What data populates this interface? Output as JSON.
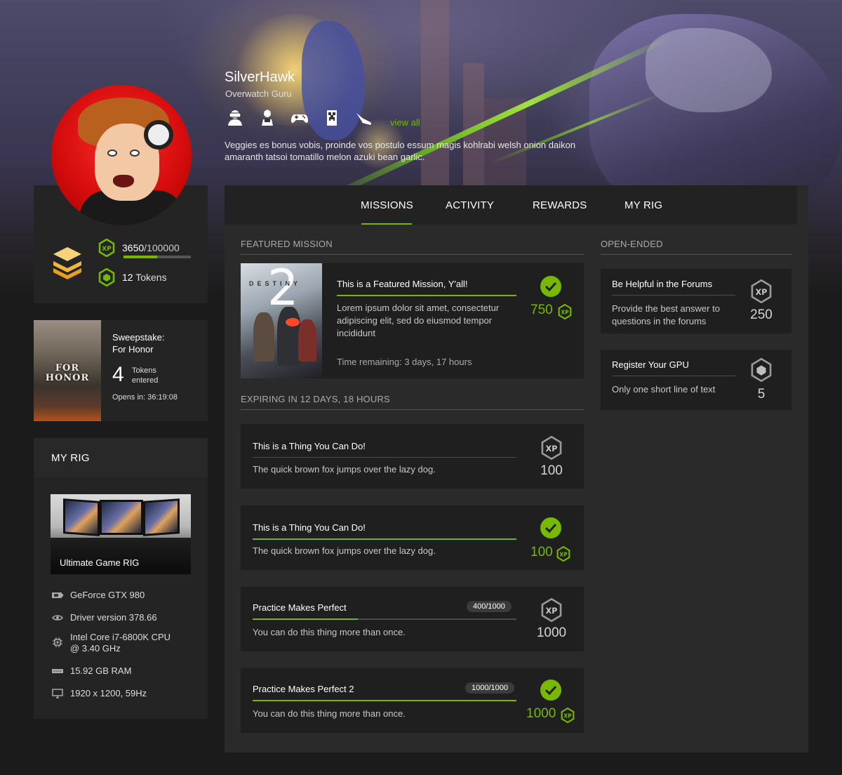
{
  "profile": {
    "username": "SilverHawk",
    "title": "Overwatch Guru",
    "badges": [
      "vr-headset-icon",
      "hacker-icon",
      "gamepad-icon",
      "creeper-icon",
      "shuttle-icon"
    ],
    "view_all": "view all",
    "bio": "Veggies es bonus vobis, proinde vos postulo essum magis kohlrabi welsh onion daikon amaranth tatsoi tomatillo melon azuki bean garlic."
  },
  "stats": {
    "xp_current": "3650",
    "xp_total": "/100000",
    "xp_progress": 0.0365,
    "xp_bar_display_fraction": 0.5,
    "tokens_count": "12",
    "tokens_label": "Tokens"
  },
  "sweepstake": {
    "title_line1": "Sweepstake:",
    "title_line2": "For Honor",
    "art_line1": "FOR",
    "art_line2": "HONOR",
    "tokens": "4",
    "tokens_label_1": "Tokens",
    "tokens_label_2": "entered",
    "opens_label": "Opens in: 36:19:08"
  },
  "rig": {
    "heading": "MY RIG",
    "image_label": "Ultimate Game RIG",
    "specs": [
      {
        "icon": "gpu-icon",
        "text": "GeForce GTX 980"
      },
      {
        "icon": "driver-icon",
        "text": "Driver version 378.66"
      },
      {
        "icon": "cpu-icon",
        "text": "Intel Core i7-6800K CPU\n@ 3.40 GHz"
      },
      {
        "icon": "ram-icon",
        "text": "15.92 GB RAM"
      },
      {
        "icon": "monitor-icon",
        "text": "1920 x 1200, 59Hz"
      }
    ]
  },
  "tabs": [
    "MISSIONS",
    "ACTIVITY",
    "REWARDS",
    "MY RIG"
  ],
  "active_tab": "MISSIONS",
  "featured": {
    "section": "FEATURED MISSION",
    "art_title": "DESTINY",
    "art_number": "2",
    "title": "This is a Featured Mission, Y'all!",
    "desc": "Lorem ipsum dolor sit amet, consectetur adipiscing elit, sed do eiusmod tempor incididunt",
    "time": "Time remaining: 3 days, 17 hours",
    "reward": "750",
    "completed": true
  },
  "expiring": {
    "section": "EXPIRING IN 12 DAYS, 18 HOURS",
    "missions": [
      {
        "title": "This is a Thing You Can Do!",
        "desc": "The quick brown fox jumps over the lazy dog.",
        "reward": "100",
        "completed": false
      },
      {
        "title": "This is a Thing You Can Do!",
        "desc": "The quick brown fox jumps over the lazy dog.",
        "reward": "100",
        "completed": true
      },
      {
        "title": "Practice Makes Perfect",
        "desc": "You can do this thing more than once.",
        "reward": "1000",
        "completed": false,
        "progress_label": "400/1000",
        "progress": 0.4
      },
      {
        "title": "Practice Makes Perfect 2",
        "desc": "You can do this thing more than once.",
        "reward": "1000",
        "completed": true,
        "progress_label": "1000/1000",
        "progress": 1.0
      }
    ]
  },
  "open_ended": {
    "section": "OPEN-ENDED",
    "missions": [
      {
        "title": "Be Helpful in the Forums",
        "desc": "Provide the best answer to questions in the forums",
        "reward": "250",
        "reward_icon": "xp-hex-icon"
      },
      {
        "title": "Register Your GPU",
        "desc": "Only one short line of text",
        "reward": "5",
        "reward_icon": "token-hex-icon"
      }
    ]
  },
  "colors": {
    "accent": "#76b900",
    "panel": "#242424",
    "card": "#1f1f1f",
    "main_bg": "#2a2a2a",
    "avatar_red": "#d70d0d"
  }
}
